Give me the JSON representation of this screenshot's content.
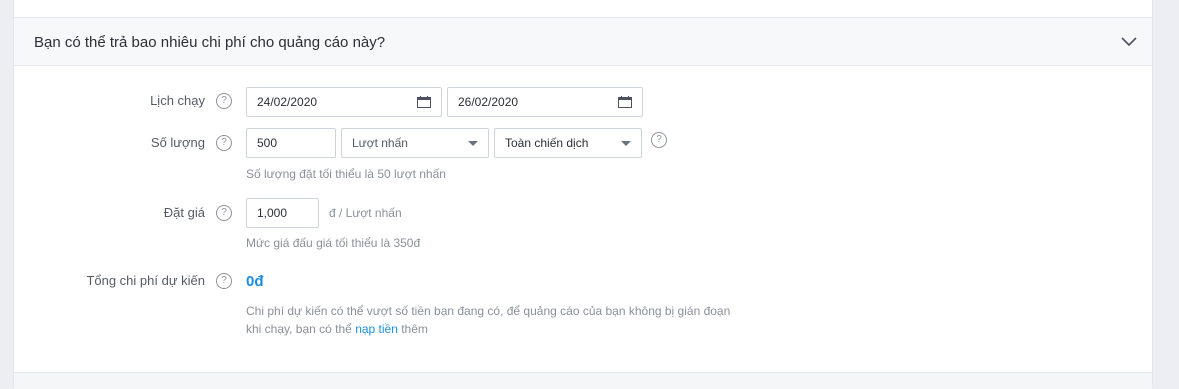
{
  "section": {
    "title": "Bạn có thể trả bao nhiêu chi phí cho quảng cáo này?"
  },
  "schedule": {
    "label": "Lịch chạy",
    "start_date": "24/02/2020",
    "end_date": "26/02/2020"
  },
  "quantity": {
    "label": "Số lượng",
    "value": "500",
    "unit_select": "Lượt nhấn",
    "scope_select": "Toàn chiến dịch",
    "hint": "Số lượng đặt tối thiểu là 50 lượt nhấn"
  },
  "price": {
    "label": "Đặt giá",
    "value": "1,000",
    "unit": "đ / Lượt nhấn",
    "hint": "Mức giá đấu giá tối thiểu là 350đ"
  },
  "total": {
    "label": "Tổng chi phí dự kiến",
    "value": "0đ",
    "note_line1": "Chi phí dự kiến có thể vượt số tiền bạn đang có, để quảng cáo của bạn không bị gián đoạn",
    "note_line2_before": "khi chạy, bạn có thể ",
    "note_link": "nạp tiền",
    "note_line2_after": " thêm"
  },
  "icons": {
    "help": "question-circle-icon",
    "calendar": "calendar-icon",
    "collapse": "chevron-down-icon"
  },
  "colors": {
    "accent": "#1a8fdc",
    "background": "#eceef3"
  }
}
